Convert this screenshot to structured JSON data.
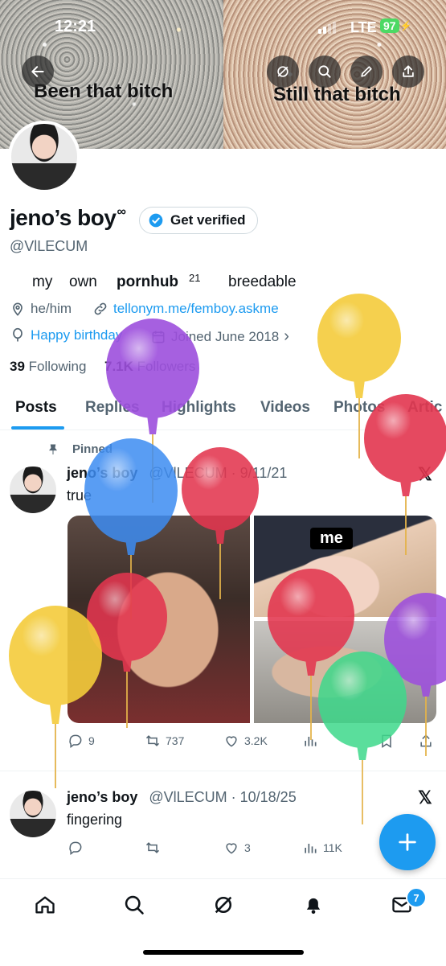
{
  "status_bar": {
    "time": "12:21",
    "network": "LTE",
    "battery": "97"
  },
  "banner": {
    "left_text": "Been that bitch",
    "right_text": "Still that bitch"
  },
  "profile": {
    "name": "jeno’s boy",
    "name_symbol": "∞",
    "verify_label": "Get verified",
    "handle": "@VlLECUM",
    "bio": {
      "w1": "my",
      "w2": "own",
      "w3": "pornhub",
      "sup": "21",
      "w4": "breedable"
    },
    "pronouns": "he/him",
    "link": "tellonym.me/femboy.askme",
    "birthday": "Happy birthday",
    "joined": "Joined June 2018",
    "following_count": "39",
    "following_label": "Following",
    "followers_count": "7.1K",
    "followers_label": "Followers"
  },
  "tabs": [
    "Posts",
    "Replies",
    "Highlights",
    "Videos",
    "Photos",
    "Artic"
  ],
  "posts": [
    {
      "pinned_label": "Pinned",
      "name": "jeno’s boy",
      "handle_date": "@VlLECUM · 9/11/21",
      "text": "true",
      "image_label": "me",
      "replies": "9",
      "reposts": "737",
      "likes": "3.2K"
    },
    {
      "name": "jeno’s boy",
      "handle_date": "@VlLECUM · 10/18/25",
      "text": "fingering",
      "likes": "3",
      "views": "11K"
    }
  ],
  "nav": {
    "messages_badge": "7"
  },
  "colors": {
    "accent": "#1d9bf0",
    "text": "#0f1419",
    "muted": "#536471"
  }
}
